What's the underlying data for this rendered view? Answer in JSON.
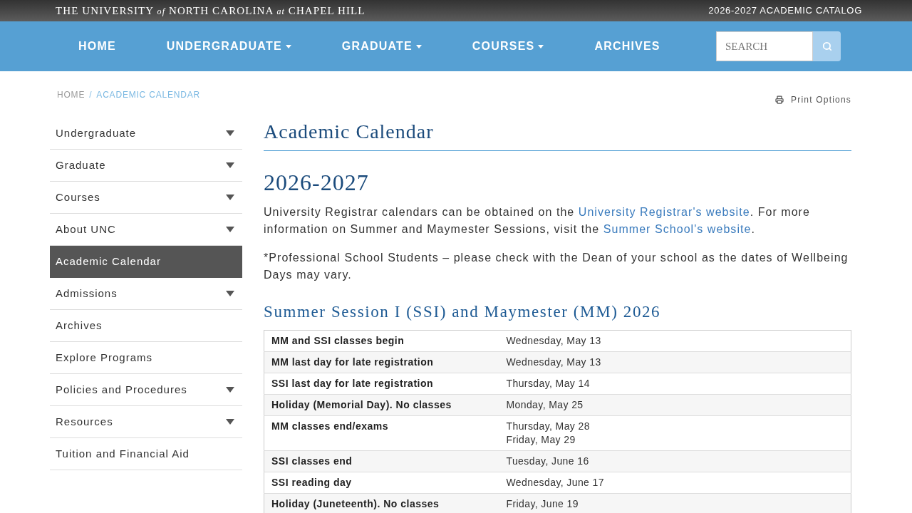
{
  "top_bar": {
    "wordmark": "THE UNIVERSITY *of* NORTH CAROLINA *at* CHAPEL HILL",
    "catalog_link": "2026-2027 ACADEMIC CATALOG"
  },
  "nav": {
    "items": [
      {
        "label": "HOME",
        "dropdown": false
      },
      {
        "label": "UNDERGRADUATE",
        "dropdown": true
      },
      {
        "label": "GRADUATE",
        "dropdown": true
      },
      {
        "label": "COURSES",
        "dropdown": true
      },
      {
        "label": "ARCHIVES",
        "dropdown": false
      }
    ],
    "search": {
      "placeholder": "SEARCH"
    }
  },
  "breadcrumb": {
    "separator": "/",
    "items": [
      {
        "label": "HOME",
        "current": false
      },
      {
        "label": "ACADEMIC CALENDAR",
        "current": true
      }
    ]
  },
  "print_options": "Print Options",
  "sidebar": {
    "items": [
      {
        "label": "Undergraduate",
        "expandable": true,
        "selected": false
      },
      {
        "label": "Graduate",
        "expandable": true,
        "selected": false
      },
      {
        "label": "Courses",
        "expandable": true,
        "selected": false
      },
      {
        "label": "About UNC",
        "expandable": true,
        "selected": false
      },
      {
        "label": "Academic Calendar",
        "expandable": false,
        "selected": true
      },
      {
        "label": "Admissions",
        "expandable": true,
        "selected": false
      },
      {
        "label": "Archives",
        "expandable": false,
        "selected": false
      },
      {
        "label": "Explore Programs",
        "expandable": false,
        "selected": false
      },
      {
        "label": "Policies and Procedures",
        "expandable": true,
        "selected": false
      },
      {
        "label": "Resources",
        "expandable": true,
        "selected": false
      },
      {
        "label": "Tuition and Financial Aid",
        "expandable": false,
        "selected": false
      }
    ]
  },
  "content": {
    "title": "Academic Calendar",
    "year": "2026-2027",
    "paragraphs": [
      [
        {
          "kind": "text",
          "text": "University Registrar calendars can be obtained on the "
        },
        {
          "kind": "link",
          "text": "University Registrar's website"
        },
        {
          "kind": "text",
          "text": ". For more information on Summer and Maymester Sessions, visit the "
        },
        {
          "kind": "link",
          "text": "Summer School's website"
        },
        {
          "kind": "text",
          "text": "."
        }
      ],
      [
        {
          "kind": "text",
          "text": "*Professional School Students – please check with the Dean of your school as the dates of Wellbeing Days may vary."
        }
      ]
    ],
    "section_heading": "Summer Session I (SSI) and Maymester (MM) 2026",
    "table": {
      "rows": [
        {
          "event": "MM and SSI classes begin",
          "dates": [
            "Wednesday, May 13"
          ]
        },
        {
          "event": "MM last day for late registration",
          "dates": [
            "Wednesday, May 13"
          ]
        },
        {
          "event": "SSI last day for late registration",
          "dates": [
            "Thursday, May 14"
          ]
        },
        {
          "event": "Holiday (Memorial Day). No classes",
          "dates": [
            "Monday, May 25"
          ]
        },
        {
          "event": "MM classes end/exams",
          "dates": [
            "Thursday, May 28",
            "Friday, May 29"
          ]
        },
        {
          "event": "SSI classes end",
          "dates": [
            "Tuesday, June 16"
          ]
        },
        {
          "event": "SSI reading day",
          "dates": [
            "Wednesday, June 17"
          ]
        },
        {
          "event": "Holiday (Juneteenth). No classes",
          "dates": [
            "Friday, June 19"
          ]
        }
      ]
    }
  }
}
